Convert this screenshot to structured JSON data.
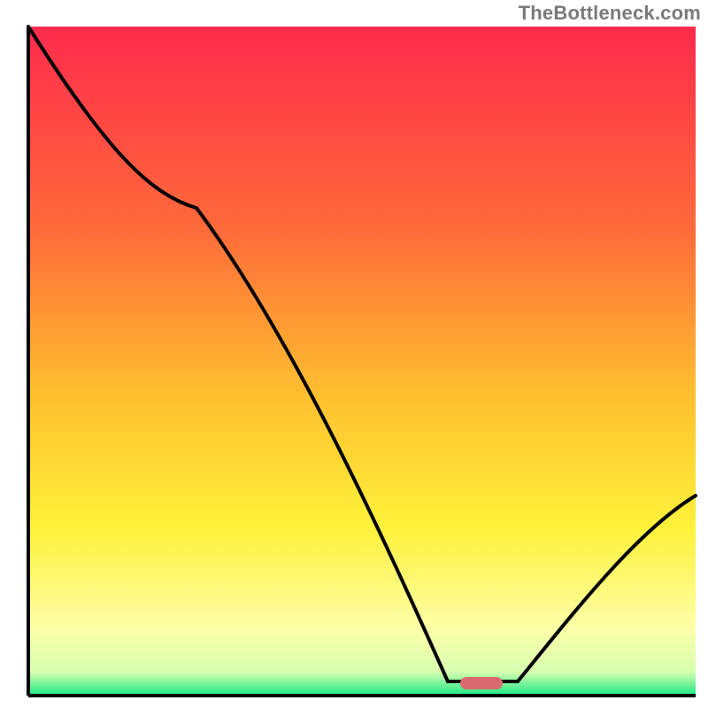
{
  "watermark": {
    "text": "TheBottleneck.com"
  },
  "chart_data": {
    "type": "line",
    "title": "",
    "xlabel": "",
    "ylabel": "",
    "xlim": [
      0,
      100
    ],
    "ylim": [
      0,
      100
    ],
    "grid": false,
    "legend": false,
    "background_gradient": {
      "stops": [
        {
          "offset": 0,
          "color": "#ff2b4c"
        },
        {
          "offset": 0.3,
          "color": "#ff6a3a"
        },
        {
          "offset": 0.55,
          "color": "#ffbf2e"
        },
        {
          "offset": 0.75,
          "color": "#fff23a"
        },
        {
          "offset": 0.9,
          "color": "#fdffa8"
        },
        {
          "offset": 0.965,
          "color": "#d7ffb0"
        },
        {
          "offset": 1.0,
          "color": "#17e884"
        }
      ]
    },
    "series": [
      {
        "name": "bottleneck-curve",
        "color": "#000000",
        "x": [
          0,
          25,
          63,
          68,
          73,
          100
        ],
        "values": [
          100,
          73,
          2,
          2,
          2,
          30
        ]
      }
    ],
    "annotations": [
      {
        "name": "optimal-marker",
        "type": "pill",
        "x": 68,
        "y": 1.5,
        "color": "#d96b6f"
      }
    ]
  }
}
